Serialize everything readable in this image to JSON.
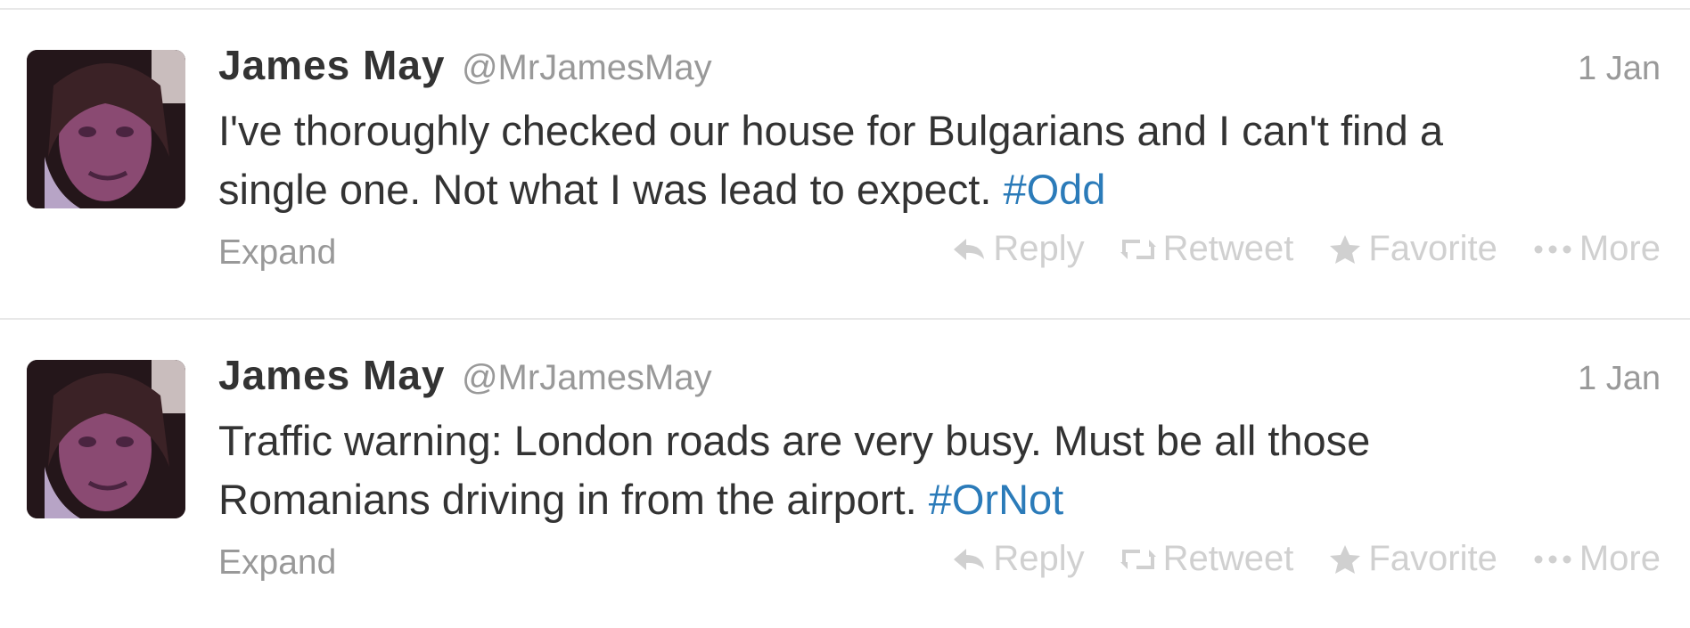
{
  "tweets": [
    {
      "author": "James May",
      "handle": "@MrJamesMay",
      "time": "1 Jan",
      "text": "I've thoroughly checked our house for Bulgarians and I can't find a single one. Not what I was lead to expect.",
      "hashtag": "#Odd",
      "expand": "Expand",
      "actions": {
        "reply": "Reply",
        "retweet": "Retweet",
        "favorite": "Favorite",
        "more": "More"
      }
    },
    {
      "author": "James May",
      "handle": "@MrJamesMay",
      "time": "1 Jan",
      "text": "Traffic warning: London roads are very busy. Must be all those Romanians driving in from the airport.",
      "hashtag": "#OrNot",
      "expand": "Expand",
      "actions": {
        "reply": "Reply",
        "retweet": "Retweet",
        "favorite": "Favorite",
        "more": "More"
      }
    }
  ],
  "icons": {
    "reply": "reply-arrow-icon",
    "retweet": "retweet-icon",
    "favorite": "star-icon",
    "more": "more-dots-icon"
  },
  "colors": {
    "hashtag": "#2b7bb9",
    "muted": "#999999",
    "action": "#d0d0d0",
    "text": "#333333"
  }
}
